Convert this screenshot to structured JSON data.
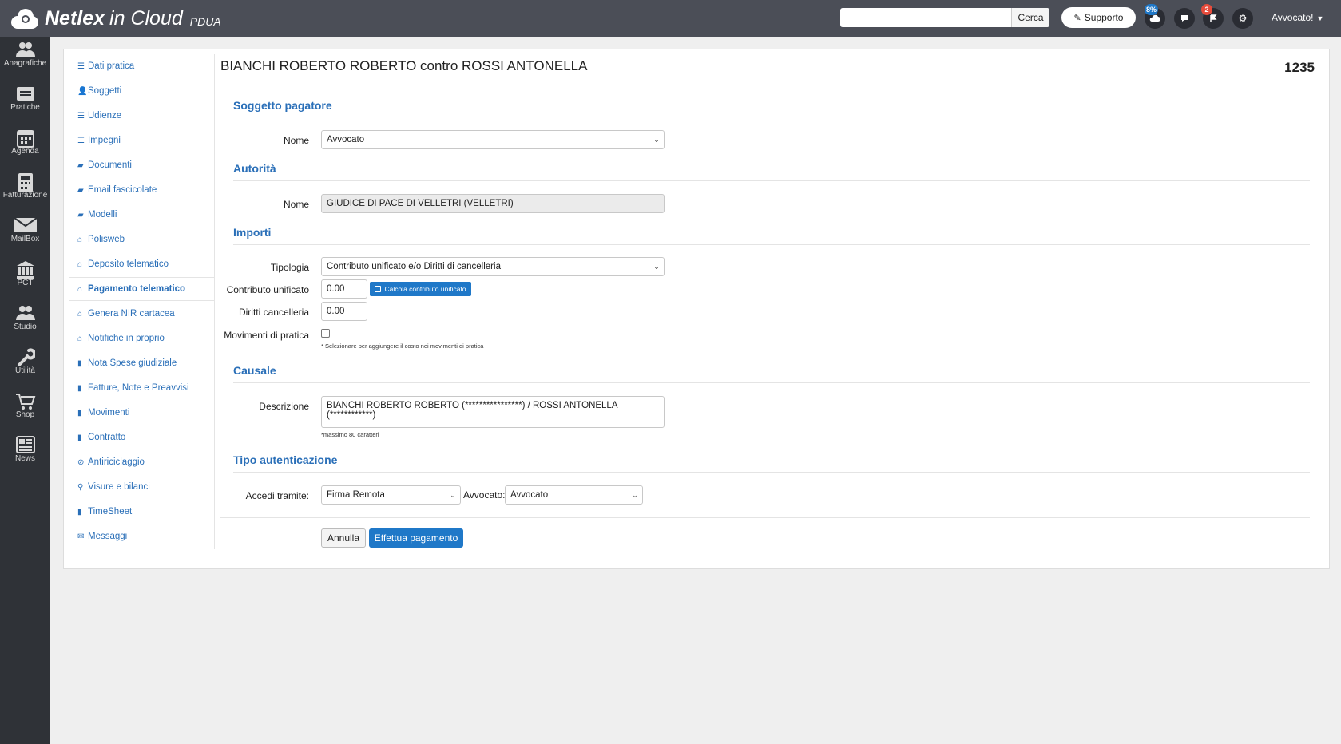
{
  "brand": {
    "name": "Netlex",
    "in_cloud": "in Cloud",
    "subtitle": "PDUA"
  },
  "header": {
    "search_placeholder": "",
    "search_button": "Cerca",
    "support_label": "Supporto",
    "cloud_badge": "8%",
    "flag_badge": "2",
    "user_label": "Avvocato!"
  },
  "leftnav": [
    {
      "label": "Anagrafiche",
      "icon": "users-icon"
    },
    {
      "label": "Pratiche",
      "icon": "folder-icon"
    },
    {
      "label": "Agenda",
      "icon": "calendar-icon"
    },
    {
      "label": "Fatturazione",
      "icon": "calculator-icon"
    },
    {
      "label": "MailBox",
      "icon": "envelope-icon"
    },
    {
      "label": "PCT",
      "icon": "courthouse-icon"
    },
    {
      "label": "Studio",
      "icon": "users-icon"
    },
    {
      "label": "Utilità",
      "icon": "wrench-icon"
    },
    {
      "label": "Shop",
      "icon": "cart-icon"
    },
    {
      "label": "News",
      "icon": "newspaper-icon"
    }
  ],
  "side_menu": [
    {
      "label": "Dati pratica",
      "icon": "list-icon"
    },
    {
      "label": "Soggetti",
      "icon": "user-icon"
    },
    {
      "label": "Udienze",
      "icon": "list-icon"
    },
    {
      "label": "Impegni",
      "icon": "list-icon"
    },
    {
      "label": "Documenti",
      "icon": "folder-open-icon"
    },
    {
      "label": "Email fascicolate",
      "icon": "folder-open-icon"
    },
    {
      "label": "Modelli",
      "icon": "folder-open-icon"
    },
    {
      "label": "Polisweb",
      "icon": "home-icon"
    },
    {
      "label": "Deposito telematico",
      "icon": "home-icon"
    },
    {
      "label": "Pagamento telematico",
      "icon": "home-icon",
      "active": true
    },
    {
      "label": "Genera NIR cartacea",
      "icon": "home-icon"
    },
    {
      "label": "Notifiche in proprio",
      "icon": "home-icon"
    },
    {
      "label": "Nota Spese giudiziale",
      "icon": "file-icon"
    },
    {
      "label": "Fatture, Note e Preavvisi",
      "icon": "file-icon"
    },
    {
      "label": "Movimenti",
      "icon": "file-icon"
    },
    {
      "label": "Contratto",
      "icon": "file-icon"
    },
    {
      "label": "Antiriciclaggio",
      "icon": "ban-icon"
    },
    {
      "label": "Visure e bilanci",
      "icon": "search-icon"
    },
    {
      "label": "TimeSheet",
      "icon": "file-icon"
    },
    {
      "label": "Messaggi",
      "icon": "envelope-icon"
    }
  ],
  "page": {
    "title": "BIANCHI ROBERTO ROBERTO contro ROSSI ANTONELLA",
    "number": "1235"
  },
  "form": {
    "soggetto": {
      "heading": "Soggetto pagatore",
      "nome_label": "Nome",
      "nome_value": "Avvocato"
    },
    "autorita": {
      "heading": "Autorità",
      "nome_label": "Nome",
      "nome_value": "GIUDICE DI PACE DI VELLETRI (VELLETRI)"
    },
    "importi": {
      "heading": "Importi",
      "tipologia_label": "Tipologia",
      "tipologia_value": "Contributo unificato e/o Diritti di cancelleria",
      "contributo_label": "Contributo unificato",
      "contributo_value": "0.00",
      "calcola_label": "Calcola contributo unificato",
      "diritti_label": "Diritti cancelleria",
      "diritti_value": "0.00",
      "movimenti_label": "Movimenti di pratica",
      "movimenti_checked": false,
      "movimenti_hint": "* Selezionare per aggiungere il costo nei movimenti di pratica"
    },
    "causale": {
      "heading": "Causale",
      "descrizione_label": "Descrizione",
      "descrizione_value": "BIANCHI ROBERTO ROBERTO (****************) / ROSSI ANTONELLA (************)",
      "hint": "*massimo 80 caratteri"
    },
    "autenticazione": {
      "heading": "Tipo autenticazione",
      "accedi_label": "Accedi tramite:",
      "accedi_value": "Firma Remota",
      "avvocato_label": "Avvocato:",
      "avvocato_value": "Avvocato"
    },
    "buttons": {
      "cancel": "Annulla",
      "submit": "Effettua pagamento"
    }
  },
  "colors": {
    "accent": "#1f78c8",
    "link": "#2a6fb8",
    "topbar": "#4b4e57",
    "sidebar": "#2f3237",
    "badge_blue": "#1f78c8",
    "badge_red": "#e74c3c"
  }
}
